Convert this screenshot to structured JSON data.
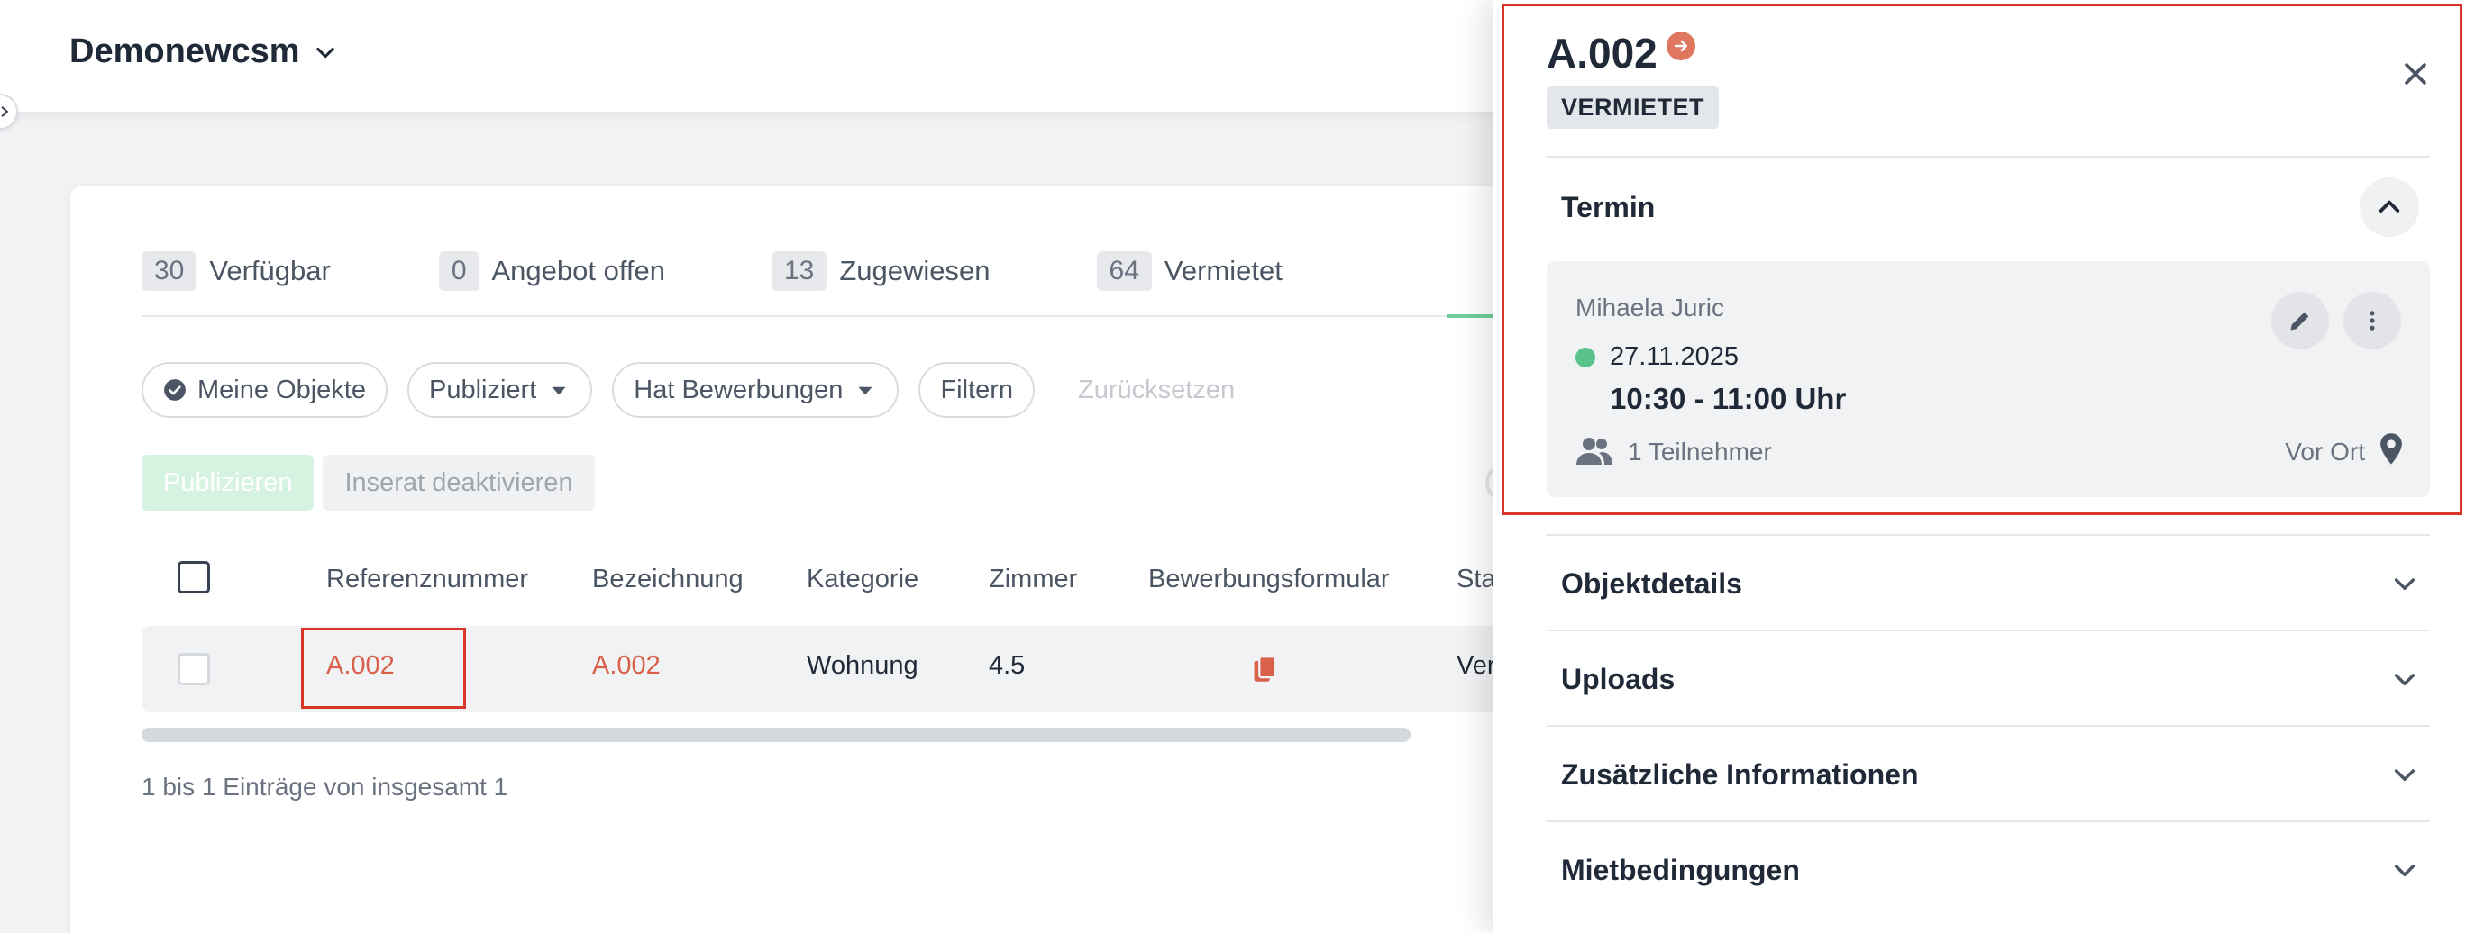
{
  "header": {
    "workspace_name": "Demonewcsm"
  },
  "status_tabs": [
    {
      "count": "30",
      "label": "Verfügbar"
    },
    {
      "count": "0",
      "label": "Angebot offen"
    },
    {
      "count": "13",
      "label": "Zugewiesen"
    },
    {
      "count": "64",
      "label": "Vermietet"
    }
  ],
  "filters": {
    "my_objects": "Meine Objekte",
    "published": "Publiziert",
    "has_applications": "Hat Bewerbungen",
    "filter": "Filtern",
    "reset": "Zurücksetzen"
  },
  "actions": {
    "publish": "Publizieren",
    "deactivate": "Inserat deaktivieren"
  },
  "table": {
    "columns": [
      "Referenznummer",
      "Bezeichnung",
      "Kategorie",
      "Zimmer",
      "Bewerbungsformular",
      "Sta"
    ],
    "rows": [
      {
        "ref": "A.002",
        "name": "A.002",
        "category": "Wohnung",
        "rooms": "4.5",
        "status": "Ver"
      }
    ],
    "footer": "1 bis 1 Einträge von insgesamt 1"
  },
  "drawer": {
    "title": "A.002",
    "badge": "VERMIETET",
    "termin_title": "Termin",
    "appointment": {
      "person": "Mihaela Juric",
      "date": "27.11.2025",
      "time": "10:30 - 11:00 Uhr",
      "participants": "1 Teilnehmer",
      "location": "Vor Ort",
      "status_color": "#58c28a"
    },
    "sections": [
      "Objektdetails",
      "Uploads",
      "Zusätzliche Informationen",
      "Mietbedingungen"
    ]
  },
  "colors": {
    "accent_link": "#d9614c",
    "highlight_border": "#d9362a",
    "active_tab": "#6fcf97"
  },
  "icons": [
    "chevron-down-icon",
    "check-circle-icon",
    "caret-down-icon",
    "copy-icon",
    "arrow-right-circle-icon",
    "close-icon",
    "chevron-up-icon",
    "pencil-icon",
    "more-vertical-icon",
    "people-icon",
    "map-pin-icon"
  ]
}
